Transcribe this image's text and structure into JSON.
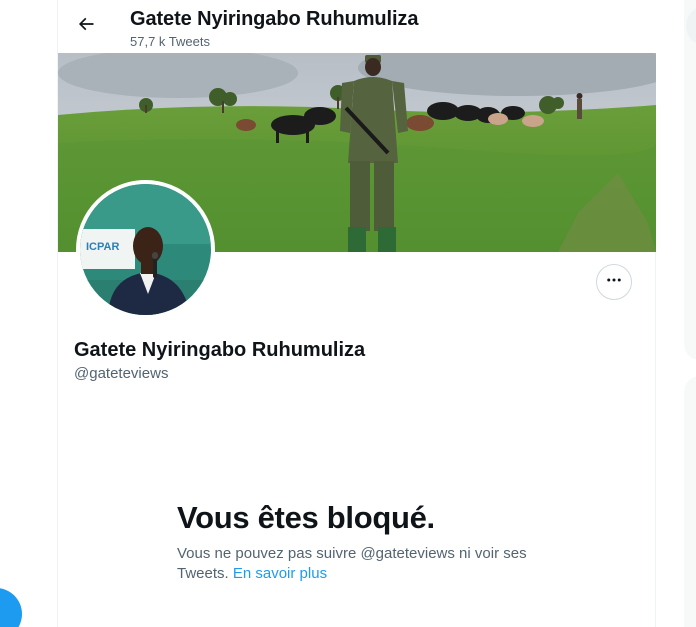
{
  "header": {
    "title": "Gatete Nyiringabo Ruhumuliza",
    "tweet_count": "57,7 k Tweets"
  },
  "profile": {
    "name": "Gatete Nyiringabo Ruhumuliza",
    "handle": "@gateteviews",
    "avatar_sign_text": "ICPAR"
  },
  "blocked": {
    "title": "Vous êtes bloqué.",
    "message": "Vous ne pouvez pas suivre @gateteviews ni voir ses Tweets.",
    "learn_more": "En savoir plus"
  },
  "icons": {
    "back": "arrow-left-icon",
    "more": "more-horizontal-icon"
  },
  "colors": {
    "accent": "#1d9bf0",
    "text_primary": "#0f1419",
    "text_secondary": "#536471",
    "border": "#eff3f4"
  }
}
